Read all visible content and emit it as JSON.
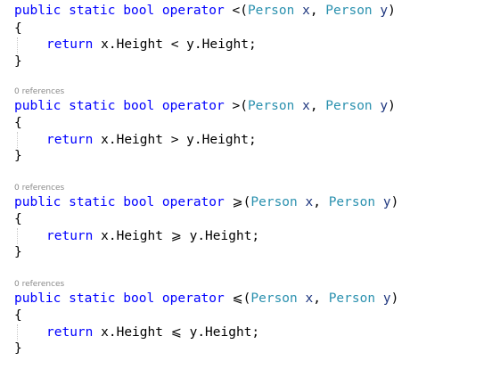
{
  "editor": {
    "colors": {
      "keyword": "#0000ff",
      "type": "#2b91af",
      "parameter": "#1f377f",
      "lens": "#8a8a8a"
    },
    "blocks": [
      {
        "lens": "",
        "kw_public": "public",
        "kw_static": "static",
        "kw_bool": "bool",
        "kw_operator": "operator",
        "op": "<",
        "open_paren": "(",
        "type1": "Person",
        "param1": "x",
        "comma": ",",
        "type2": "Person",
        "param2": "y",
        "close_paren": ")",
        "open_brace": "{",
        "kw_return": "return",
        "expr_left": "x.Height",
        "expr_op": "<",
        "expr_right": "y.Height;",
        "close_brace": "}"
      },
      {
        "lens": "0 references",
        "kw_public": "public",
        "kw_static": "static",
        "kw_bool": "bool",
        "kw_operator": "operator",
        "op": ">",
        "open_paren": "(",
        "type1": "Person",
        "param1": "x",
        "comma": ",",
        "type2": "Person",
        "param2": "y",
        "close_paren": ")",
        "open_brace": "{",
        "kw_return": "return",
        "expr_left": "x.Height",
        "expr_op": ">",
        "expr_right": "y.Height;",
        "close_brace": "}"
      },
      {
        "lens": "0 references",
        "kw_public": "public",
        "kw_static": "static",
        "kw_bool": "bool",
        "kw_operator": "operator",
        "op": "⩾",
        "open_paren": "(",
        "type1": "Person",
        "param1": "x",
        "comma": ",",
        "type2": "Person",
        "param2": "y",
        "close_paren": ")",
        "open_brace": "{",
        "kw_return": "return",
        "expr_left": "x.Height",
        "expr_op": "⩾",
        "expr_right": "y.Height;",
        "close_brace": "}"
      },
      {
        "lens": "0 references",
        "kw_public": "public",
        "kw_static": "static",
        "kw_bool": "bool",
        "kw_operator": "operator",
        "op": "⩽",
        "open_paren": "(",
        "type1": "Person",
        "param1": "x",
        "comma": ",",
        "type2": "Person",
        "param2": "y",
        "close_paren": ")",
        "open_brace": "{",
        "kw_return": "return",
        "expr_left": "x.Height",
        "expr_op": "⩽",
        "expr_right": "y.Height;",
        "close_brace": "}"
      }
    ]
  }
}
